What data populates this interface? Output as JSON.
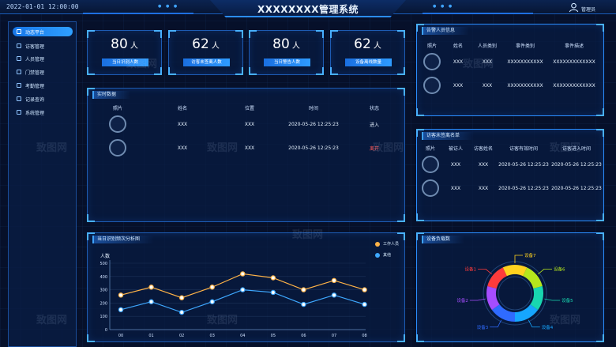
{
  "header": {
    "datetime": "2022-01-01 12:00:00",
    "title": "XXXXXXXX管理系统",
    "user_label": "管理员"
  },
  "sidebar": {
    "items": [
      {
        "label": "动态平台",
        "active": true
      },
      {
        "label": "访客管理"
      },
      {
        "label": "人员管理"
      },
      {
        "label": "门禁管理"
      },
      {
        "label": "考勤管理"
      },
      {
        "label": "记录查询"
      },
      {
        "label": "系统管理"
      }
    ]
  },
  "stats": [
    {
      "value": "80",
      "unit": "人",
      "label": "当日识别人数"
    },
    {
      "value": "62",
      "unit": "人",
      "label": "访客未签离人数"
    },
    {
      "value": "80",
      "unit": "人",
      "label": "当日警告人数"
    },
    {
      "value": "62",
      "unit": "人",
      "label": "设备离线数量"
    }
  ],
  "realtime": {
    "title": "实时数据",
    "headers": [
      "照片",
      "姓名",
      "位置",
      "时间",
      "状态"
    ],
    "rows": [
      {
        "name": "XXX",
        "location": "XXX",
        "time": "2020-05-26 12:25:23",
        "status": "进入",
        "status_color": "#ffffff"
      },
      {
        "name": "XXX",
        "location": "XXX",
        "time": "2020-05-26 12:25:23",
        "status": "离开",
        "status_color": "#ff5a5a"
      }
    ]
  },
  "alert": {
    "title": "告警人员信息",
    "headers": [
      "照片",
      "姓名",
      "人员类别",
      "事件类别",
      "事件描述"
    ],
    "rows": [
      {
        "name": "XXX",
        "category": "XXX",
        "event_type": "XXXXXXXXXXX",
        "event_desc": "XXXXXXXXXXXXX"
      },
      {
        "name": "XXX",
        "category": "XXX",
        "event_type": "XXXXXXXXXXX",
        "event_desc": "XXXXXXXXXXXXX"
      }
    ]
  },
  "visitors": {
    "title": "访客未签离名单",
    "headers": [
      "照片",
      "被访人",
      "访客姓名",
      "访客有效时间",
      "访客进入时间"
    ],
    "rows": [
      {
        "host": "XXX",
        "visitor": "XXX",
        "valid_time": "2020-05-26 12:25:23",
        "enter_time": "2020-05-26 12:25:23"
      },
      {
        "host": "XXX",
        "visitor": "XXX",
        "valid_time": "2020-05-26 12:25:23",
        "enter_time": "2020-05-26 12:25:23"
      }
    ]
  },
  "line_panel": {
    "title": "当日识别频次分析图"
  },
  "donut_panel": {
    "title": "设备负载数"
  },
  "chart_data": [
    {
      "type": "line",
      "title": "",
      "ylabel": "人数",
      "x": [
        "00",
        "01",
        "02",
        "03",
        "04",
        "05",
        "06",
        "07",
        "08"
      ],
      "ylim": [
        0,
        500
      ],
      "yticks": [
        0,
        100,
        200,
        300,
        400,
        500
      ],
      "grid": true,
      "legend_position": "top-right",
      "series": [
        {
          "name": "工作人员",
          "color": "#ffb347",
          "values": [
            260,
            320,
            240,
            320,
            420,
            390,
            300,
            370,
            300
          ]
        },
        {
          "name": "其他",
          "color": "#3ea8ff",
          "values": [
            150,
            210,
            130,
            210,
            300,
            280,
            190,
            260,
            190
          ]
        }
      ]
    },
    {
      "type": "pie",
      "title": "",
      "categories": [
        "设备7",
        "设备6",
        "设备5",
        "设备4",
        "设备3",
        "设备2",
        "设备1"
      ],
      "values": [
        14,
        14,
        14,
        15,
        15,
        14,
        14
      ],
      "colors": [
        "#ffd21f",
        "#b5e61d",
        "#18d6b0",
        "#16a6ff",
        "#2f6bff",
        "#a64dff",
        "#ff3b3b"
      ]
    }
  ],
  "watermark": "致图网"
}
